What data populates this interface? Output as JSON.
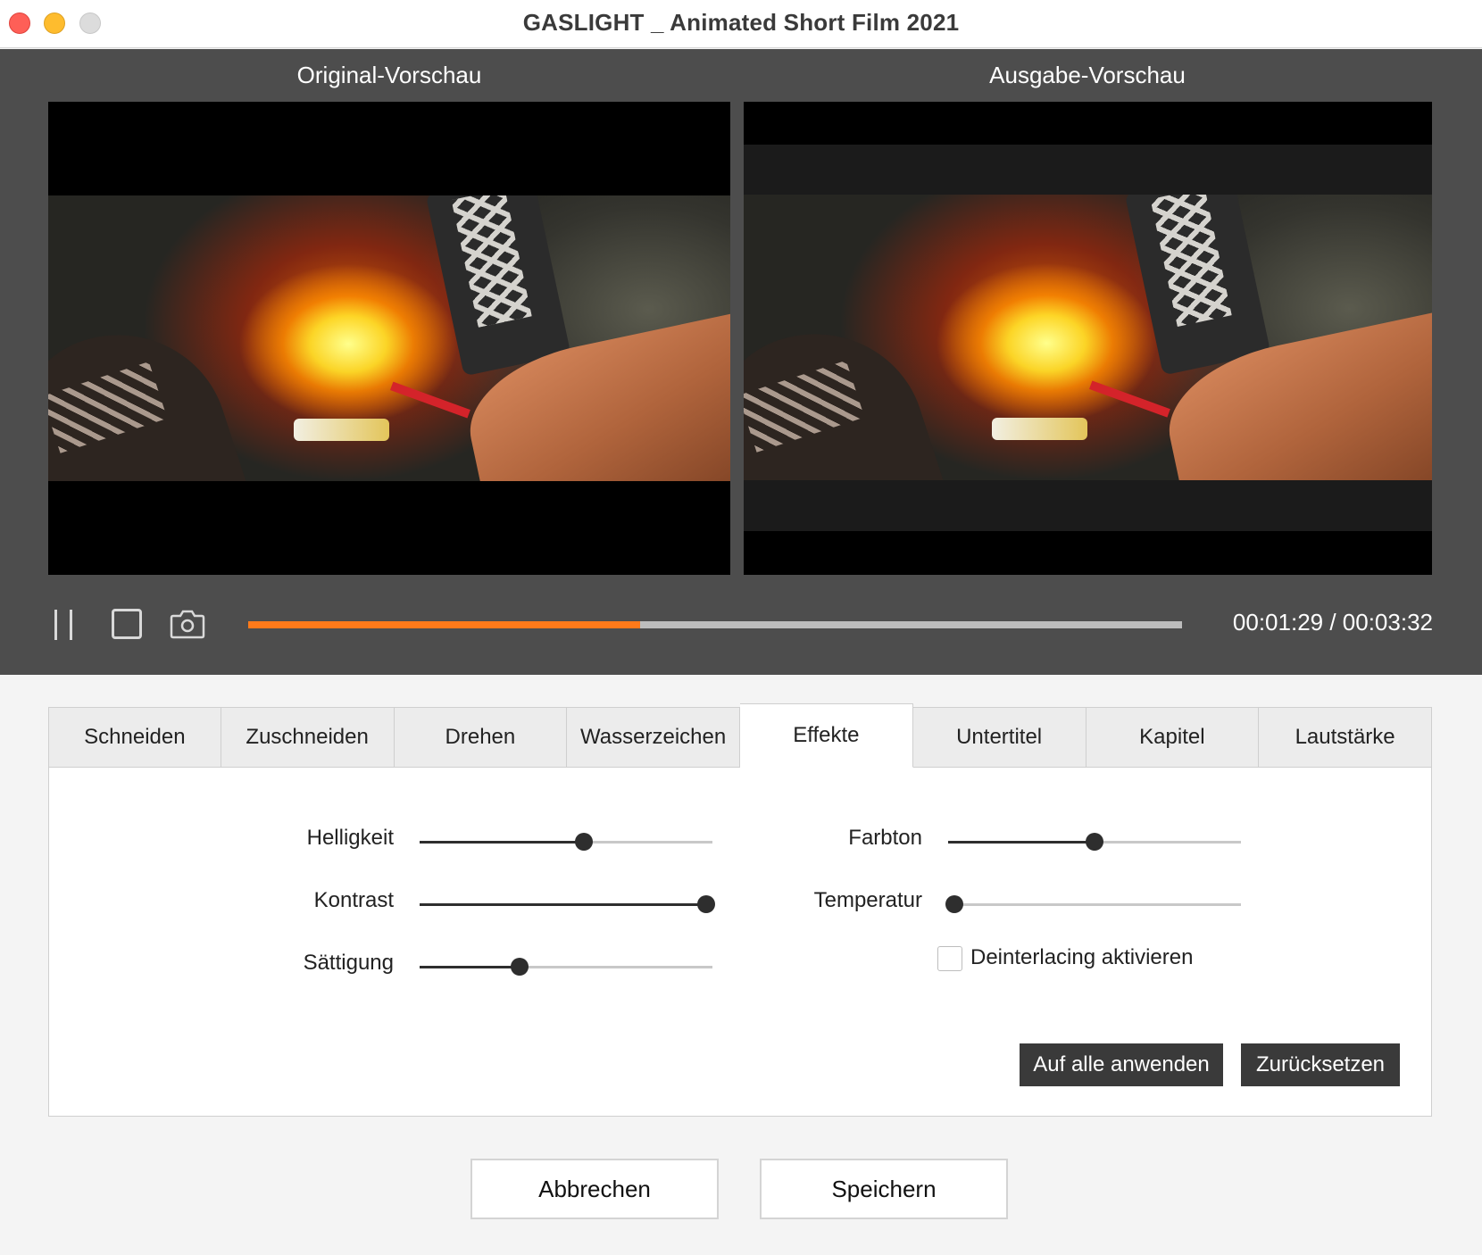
{
  "window": {
    "title": "GASLIGHT _ Animated Short Film 2021"
  },
  "preview": {
    "original_label": "Original-Vorschau",
    "output_label": "Ausgabe-Vorschau"
  },
  "playback": {
    "timecode": "00:01:29 / 00:03:32",
    "progress_fraction": 0.42,
    "progress_color": "#ff7a1a"
  },
  "tabs": [
    {
      "label": "Schneiden"
    },
    {
      "label": "Zuschneiden"
    },
    {
      "label": "Drehen"
    },
    {
      "label": "Wasserzeichen"
    },
    {
      "label": "Effekte",
      "active": true
    },
    {
      "label": "Untertitel"
    },
    {
      "label": "Kapitel"
    },
    {
      "label": "Lautstärke"
    }
  ],
  "effects": {
    "brightness": {
      "label": "Helligkeit",
      "value": 0.56
    },
    "contrast": {
      "label": "Kontrast",
      "value": 0.98
    },
    "saturation": {
      "label": "Sättigung",
      "value": 0.34
    },
    "hue": {
      "label": "Farbton",
      "value": 0.5
    },
    "temperature": {
      "label": "Temperatur",
      "value": 0.02
    },
    "deinterlace": {
      "label": "Deinterlacing aktivieren",
      "checked": false
    }
  },
  "panel_buttons": {
    "apply_all": "Auf alle anwenden",
    "reset": "Zurücksetzen"
  },
  "footer": {
    "cancel": "Abbrechen",
    "save": "Speichern"
  }
}
